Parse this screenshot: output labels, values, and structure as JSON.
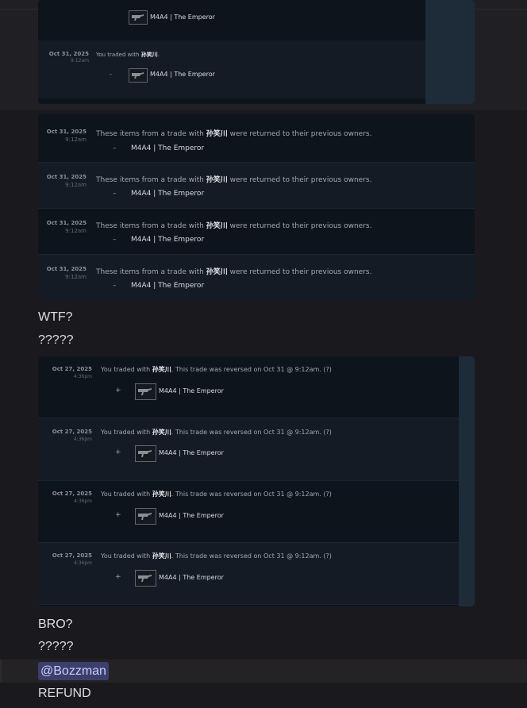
{
  "screenshot1": {
    "rows": [
      {
        "date": "",
        "time": "",
        "partner": "",
        "sign": "",
        "item": "M4A4 | The Emperor"
      },
      {
        "date": "Oct 31, 2025",
        "time": "9:12am",
        "text_before": "You traded with ",
        "partner": "孙笑川",
        "text_after": ".",
        "sign": "-",
        "item": "M4A4 | The Emperor"
      }
    ]
  },
  "screenshot2": {
    "rows": [
      {
        "date": "Oct 31, 2025",
        "time": "9:12am",
        "text_before": "These items from a trade with ",
        "partner": "孙笑川",
        "text_after": " were returned to their previous owners.",
        "sign": "–",
        "item": "M4A4 | The Emperor"
      },
      {
        "date": "Oct 31, 2025",
        "time": "9:12am",
        "text_before": "These items from a trade with ",
        "partner": "孙笑川",
        "text_after": " were returned to their previous owners.",
        "sign": "–",
        "item": "M4A4 | The Emperor"
      },
      {
        "date": "Oct 31, 2025",
        "time": "9:12am",
        "text_before": "These items from a trade with ",
        "partner": "孙笑川",
        "text_after": " were returned to their previous owners.",
        "sign": "–",
        "item": "M4A4 | The Emperor"
      },
      {
        "date": "Oct 31, 2025",
        "time": "9:12am",
        "text_before": "These items from a trade with ",
        "partner": "孙笑川",
        "text_after": " were returned to their previous owners.",
        "sign": "–",
        "item": "M4A4 | The Emperor"
      }
    ]
  },
  "messages": {
    "wtf": "WTF?",
    "q1": "?????",
    "bro": "BRO?",
    "q2": "?????",
    "mention": "@Bozzman",
    "refund": "REFUND"
  },
  "screenshot3": {
    "rows": [
      {
        "date": "Oct 27, 2025",
        "time": "4:36pm",
        "text_before": "You traded with ",
        "partner": "孙笑川",
        "text_after": ". This trade was reversed on Oct 31 @ 9:12am. (?)",
        "sign": "+",
        "item": "M4A4 | The Emperor"
      },
      {
        "date": "Oct 27, 2025",
        "time": "4:36pm",
        "text_before": "You traded with ",
        "partner": "孙笑川",
        "text_after": ". This trade was reversed on Oct 31 @ 9:12am. (?)",
        "sign": "+",
        "item": "M4A4 | The Emperor"
      },
      {
        "date": "Oct 27, 2025",
        "time": "4:36pm",
        "text_before": "You traded with ",
        "partner": "孙笑川",
        "text_after": ". This trade was reversed on Oct 31 @ 9:12am. (?)",
        "sign": "+",
        "item": "M4A4 | The Emperor"
      },
      {
        "date": "Oct 27, 2025",
        "time": "4:36pm",
        "text_before": "You traded with ",
        "partner": "孙笑川",
        "text_after": ". This trade was reversed on Oct 31 @ 9:12am. (?)",
        "sign": "+",
        "item": "M4A4 | The Emperor"
      }
    ]
  },
  "colors": {
    "background": "#1a1a1e",
    "row_dark": "#0e141b",
    "row_light": "#141b25",
    "mention_bg": "#3c3f6e",
    "mention_text": "#c9cdf6"
  },
  "icons": [
    "rifle-thumbnail-icon"
  ]
}
